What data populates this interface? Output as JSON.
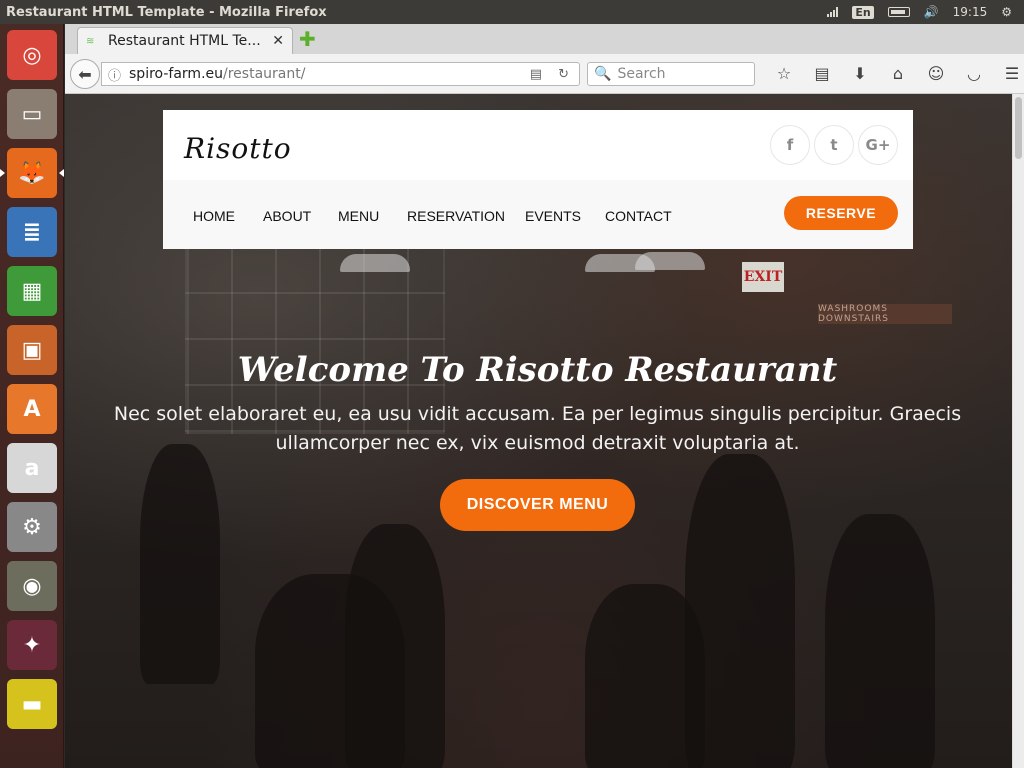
{
  "system": {
    "window_title": "Restaurant HTML Template - Mozilla Firefox",
    "language": "En",
    "clock": "19:15"
  },
  "launcher": {
    "apps": [
      {
        "name": "ubuntu-dash-icon",
        "glyph": "◎",
        "color": "#d9463b"
      },
      {
        "name": "files-icon",
        "glyph": "▭",
        "color": "#8a7d72"
      },
      {
        "name": "firefox-icon",
        "glyph": "🦊",
        "color": "#e66a1e"
      },
      {
        "name": "writer-icon",
        "glyph": "≣",
        "color": "#3a74b8"
      },
      {
        "name": "calc-icon",
        "glyph": "▦",
        "color": "#3f9a3a"
      },
      {
        "name": "impress-icon",
        "glyph": "▣",
        "color": "#c8642a"
      },
      {
        "name": "software-center-icon",
        "glyph": "A",
        "color": "#e7772a"
      },
      {
        "name": "amazon-icon",
        "glyph": "a",
        "color": "#d7d7d7"
      },
      {
        "name": "system-settings-icon",
        "glyph": "⚙",
        "color": "#888888"
      },
      {
        "name": "gimp-icon",
        "glyph": "◉",
        "color": "#6d6d5e"
      },
      {
        "name": "wizard-icon",
        "glyph": "✦",
        "color": "#6a2a3a"
      },
      {
        "name": "ruler-icon",
        "glyph": "▬",
        "color": "#d6c21d"
      },
      {
        "name": "chromium-icon",
        "glyph": "○",
        "color": "#4a86d8"
      }
    ]
  },
  "browser": {
    "tab_title": "Restaurant HTML Te...",
    "url_host": "spiro-farm.eu",
    "url_path": "/restaurant/",
    "search_placeholder": "Search"
  },
  "site": {
    "brand": "Risotto",
    "social": [
      "f",
      "t",
      "G+"
    ],
    "nav": [
      "HOME",
      "ABOUT",
      "MENU",
      "RESERVATION",
      "EVENTS",
      "CONTACT"
    ],
    "reserve_label": "RESERVE",
    "hero_title": "Welcome To Risotto Restaurant",
    "hero_subtitle": "Nec solet elaboraret eu, ea usu vidit accusam. Ea per legimus singulis percipitur. Graecis ullamcorper nec ex, vix euismod detraxit voluptaria at.",
    "discover_label": "DISCOVER MENU",
    "background_signs": {
      "exit": "EXIT",
      "washrooms": "WASHROOMS DOWNSTAIRS"
    }
  },
  "colors": {
    "accent": "#f26b0c",
    "topbar": "#3c3b37",
    "launcher": "#4a2a25"
  }
}
